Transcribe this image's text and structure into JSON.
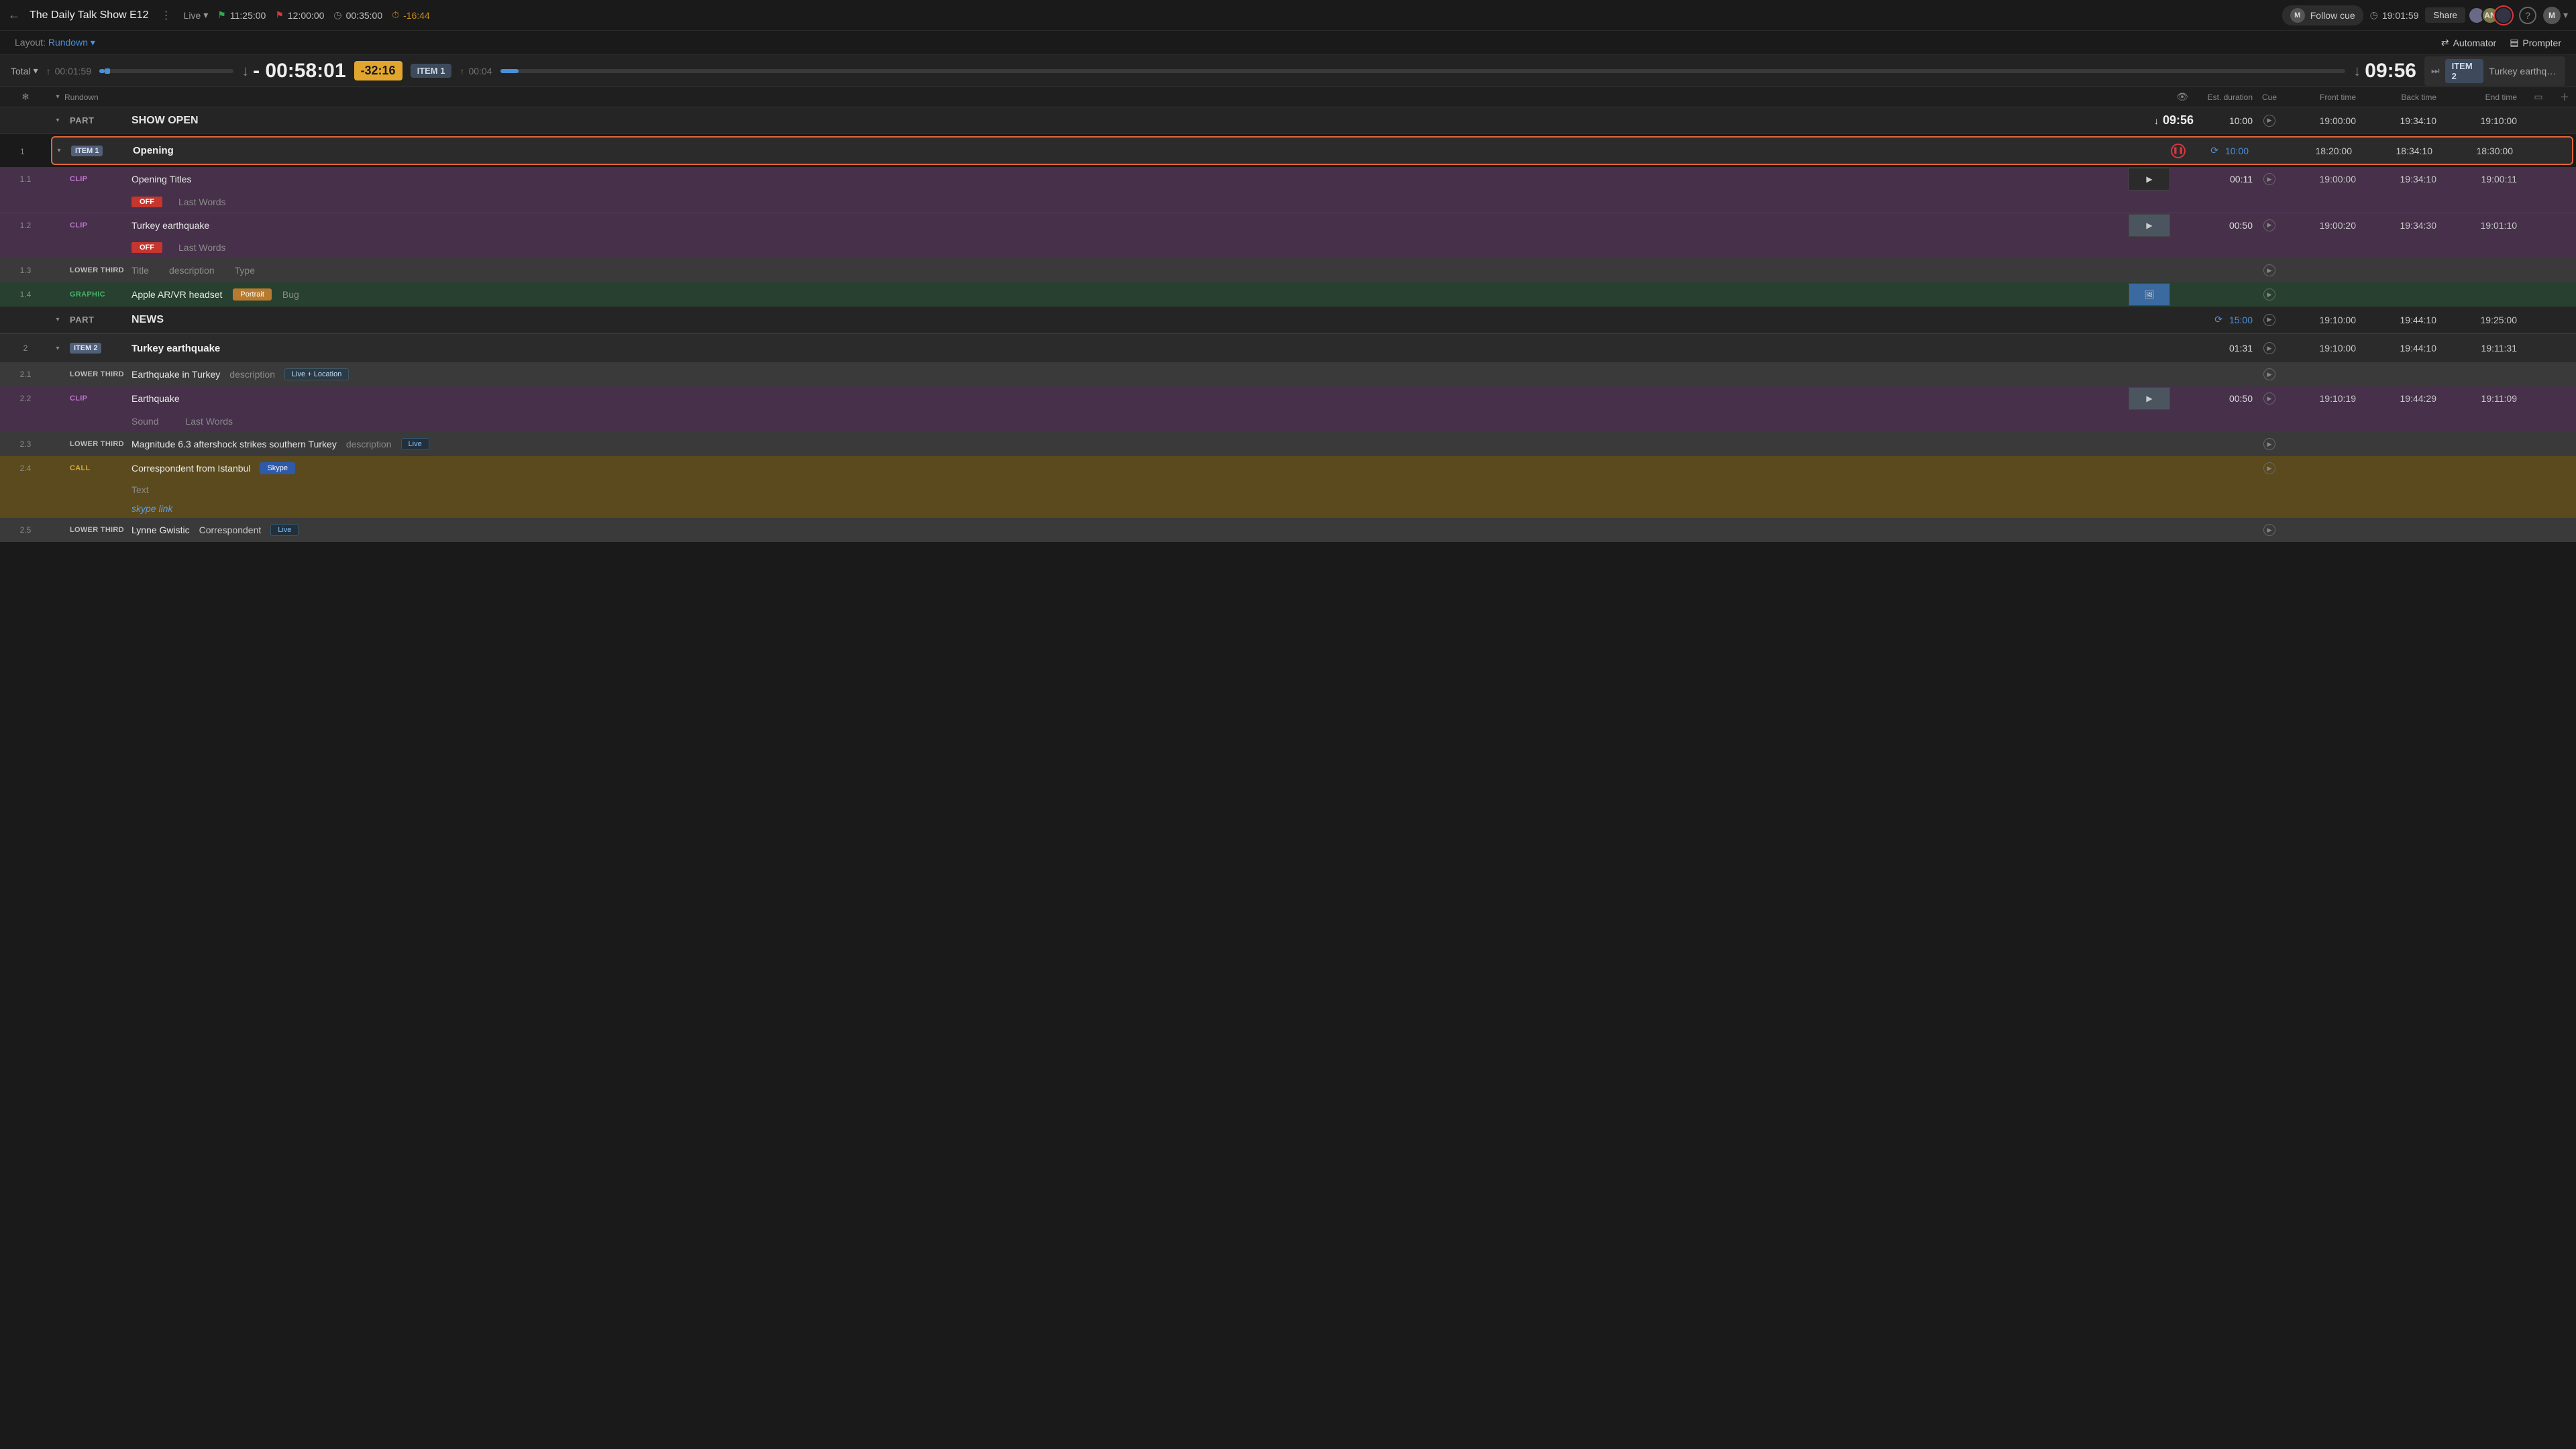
{
  "header": {
    "title": "The Daily Talk Show E12",
    "live_label": "Live",
    "green_flag_time": "11:25:00",
    "red_flag_time": "12:00:00",
    "stopwatch_time": "00:35:00",
    "countdown_time": "-16:44",
    "follow_cue_label": "Follow cue",
    "clock_right": "19:01:59",
    "share_label": "Share",
    "user_initial": "M",
    "avatar2_label": "AN"
  },
  "secondbar": {
    "layout_label": "Layout:",
    "layout_value": "Rundown",
    "automator_label": "Automator",
    "prompter_label": "Prompter"
  },
  "timing": {
    "total_label": "Total",
    "elapsed": "00:01:59",
    "main_remaining": "- 00:58:01",
    "diff": "-32:16",
    "current_item": "ITEM 1",
    "item_elapsed": "00:04",
    "item_remaining": "09:56",
    "next_item_chip": "ITEM 2",
    "next_item_label": "Turkey earthqua…"
  },
  "columns": {
    "rundown": "Rundown",
    "est": "Est. duration",
    "cue": "Cue",
    "front": "Front time",
    "back": "Back time",
    "end": "End time"
  },
  "parts": [
    {
      "label": "PART",
      "title": "SHOW OPEN",
      "countdown": "09:56",
      "est": "10:00",
      "front": "19:00:00",
      "back": "19:34:10",
      "end": "19:10:00"
    },
    {
      "label": "PART",
      "title": "NEWS",
      "est": "15:00",
      "front": "19:10:00",
      "back": "19:44:10",
      "end": "19:25:00"
    }
  ],
  "items": {
    "i1": {
      "num": "1",
      "chip": "ITEM 1",
      "title": "Opening",
      "est": "10:00",
      "front": "18:20:00",
      "back": "18:34:10",
      "end": "18:30:00"
    },
    "i11": {
      "num": "1.1",
      "tag": "CLIP",
      "title": "Opening Titles",
      "est": "00:11",
      "front": "19:00:00",
      "back": "19:34:10",
      "end": "19:00:11",
      "off": "OFF",
      "meta": "Last Words"
    },
    "i12": {
      "num": "1.2",
      "tag": "CLIP",
      "title": "Turkey earthquake",
      "est": "00:50",
      "front": "19:00:20",
      "back": "19:34:30",
      "end": "19:01:10",
      "off": "OFF",
      "meta": "Last Words"
    },
    "i13": {
      "num": "1.3",
      "tag": "LOWER THIRD",
      "ph_title": "Title",
      "ph_desc": "description",
      "ph_type": "Type"
    },
    "i14": {
      "num": "1.4",
      "tag": "GRAPHIC",
      "title": "Apple AR/VR headset",
      "chip": "Portrait",
      "ph_bug": "Bug"
    },
    "i2": {
      "num": "2",
      "chip": "ITEM 2",
      "title": "Turkey earthquake",
      "est": "01:31",
      "front": "19:10:00",
      "back": "19:44:10",
      "end": "19:11:31"
    },
    "i21": {
      "num": "2.1",
      "tag": "LOWER THIRD",
      "title": "Earthquake in Turkey",
      "ph_desc": "description",
      "chip": "Live + Location"
    },
    "i22": {
      "num": "2.2",
      "tag": "CLIP",
      "title": "Earthquake",
      "est": "00:50",
      "front": "19:10:19",
      "back": "19:44:29",
      "end": "19:11:09",
      "ph_sound": "Sound",
      "ph_last": "Last Words"
    },
    "i23": {
      "num": "2.3",
      "tag": "LOWER THIRD",
      "title": "Magnitude 6.3 aftershock strikes southern Turkey",
      "ph_desc": "description",
      "chip": "Live"
    },
    "i24": {
      "num": "2.4",
      "tag": "CALL",
      "title": "Correspondent from Istanbul",
      "chip": "Skype",
      "ph_text": "Text",
      "link": "skype link"
    },
    "i25": {
      "num": "2.5",
      "tag": "LOWER THIRD",
      "title": "Lynne Gwistic",
      "desc": "Correspondent",
      "chip": "Live"
    }
  }
}
